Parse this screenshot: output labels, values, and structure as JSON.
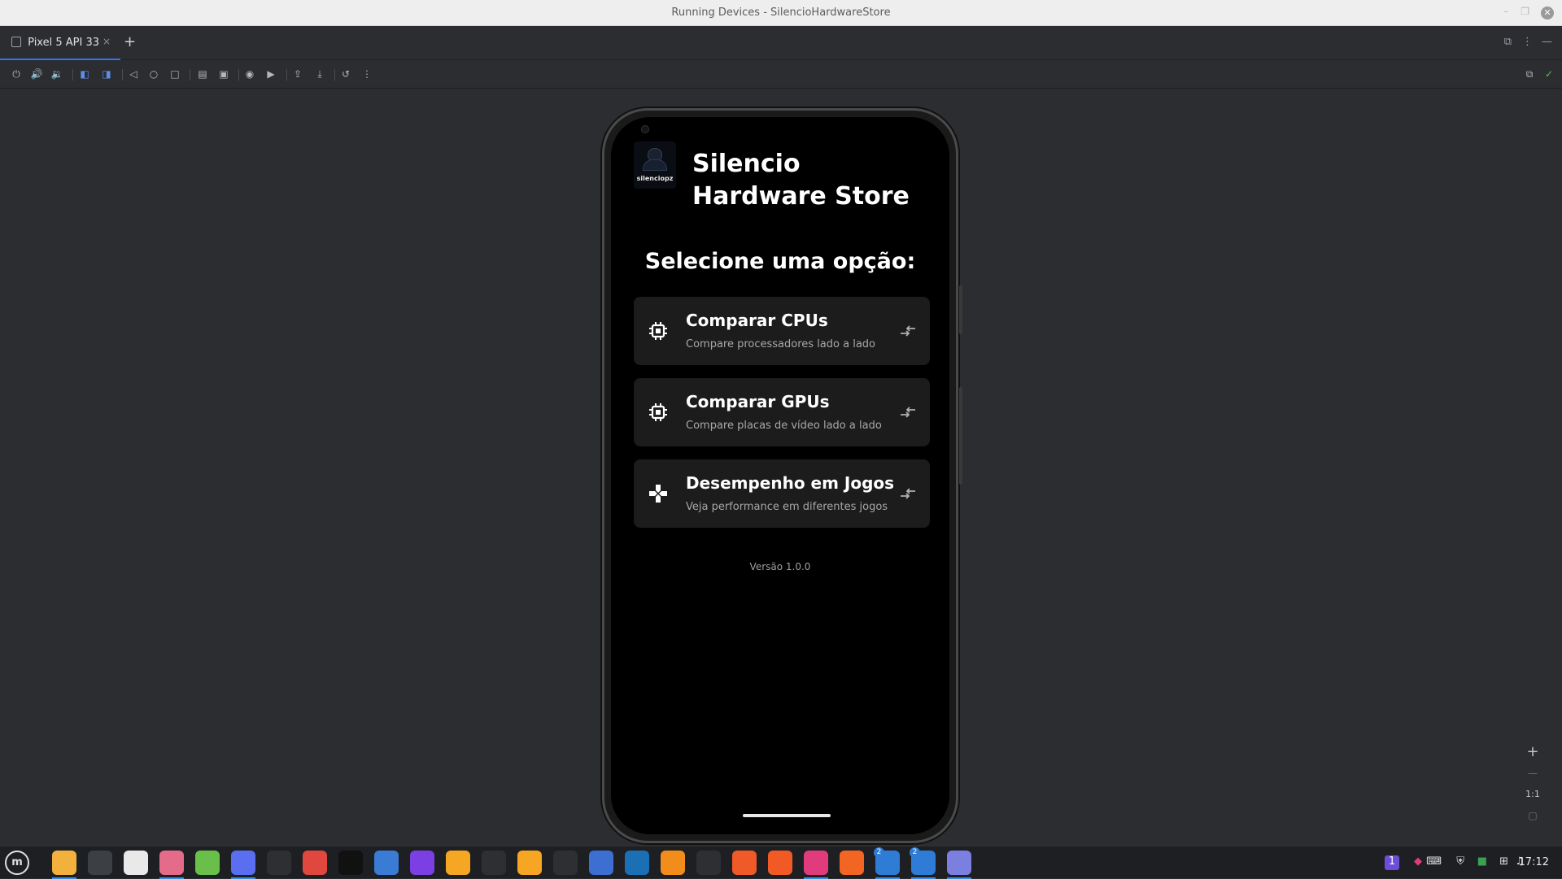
{
  "window": {
    "title": "Running Devices - SilencioHardwareStore",
    "controls": [
      "–",
      "❐",
      "✕"
    ]
  },
  "tabs": [
    {
      "label": "Pixel 5 API 33",
      "close": "×"
    }
  ],
  "add_tab": "+",
  "toolbar": {
    "left_icons": [
      "power-icon",
      "volume-up-icon",
      "volume-down-icon",
      "rotate-left-icon",
      "rotate-right-icon",
      "back-icon",
      "home-icon",
      "overview-icon",
      "fold-icon",
      "mirror-icon",
      "screenshot-icon",
      "record-icon",
      "export-icon",
      "import-icon",
      "reset-icon",
      "more-icon"
    ],
    "right_icons": [
      "device-mirror-icon",
      "check-icon"
    ]
  },
  "app": {
    "logo_text": "silenciopz",
    "title": "Silencio Hardware Store",
    "subtitle": "Selecione uma opção:",
    "cards": [
      {
        "title": "Comparar CPUs",
        "desc": "Compare processadores lado a lado",
        "icon": "cpu-chip-icon"
      },
      {
        "title": "Comparar GPUs",
        "desc": "Compare placas de vídeo lado a lado",
        "icon": "gpu-chip-icon"
      },
      {
        "title": "Desempenho em Jogos",
        "desc": "Veja performance em diferentes jogos",
        "icon": "gamepad-icon"
      }
    ],
    "version": "Versão 1.0.0"
  },
  "zoom": {
    "in": "+",
    "out": "—",
    "ratio": "1:1"
  },
  "taskbar": {
    "apps": [
      {
        "name": "files",
        "color": "#f2b13c"
      },
      {
        "name": "calculator",
        "color": "#3c3f44"
      },
      {
        "name": "calendar",
        "color": "#e9e9e9"
      },
      {
        "name": "thermometer",
        "color": "#e46c8a"
      },
      {
        "name": "spreadsheet",
        "color": "#6abf4b"
      },
      {
        "name": "vpn",
        "color": "#5a6ef0"
      },
      {
        "name": "video-editor",
        "color": "#2e2f33"
      },
      {
        "name": "screen-recorder",
        "color": "#e0473f"
      },
      {
        "name": "terminal",
        "color": "#111111"
      },
      {
        "name": "qbittorrent",
        "color": "#3a7bd5"
      },
      {
        "name": "podcast",
        "color": "#7b3fe4"
      },
      {
        "name": "game-launcher",
        "color": "#f5a623"
      },
      {
        "name": "controller",
        "color": "#2e2f33"
      },
      {
        "name": "gimp",
        "color": "#f6a623"
      },
      {
        "name": "color-picker",
        "color": "#2e2f33"
      },
      {
        "name": "bookmarks",
        "color": "#3c6fd1"
      },
      {
        "name": "steam",
        "color": "#1b6fb5"
      },
      {
        "name": "vlc",
        "color": "#f28c1a"
      },
      {
        "name": "clock",
        "color": "#2e2f33"
      },
      {
        "name": "update",
        "color": "#f05a28"
      },
      {
        "name": "brave",
        "color": "#f15a24"
      },
      {
        "name": "jetbrains",
        "color": "#e03c7d"
      },
      {
        "name": "draw",
        "color": "#f26522"
      },
      {
        "name": "android-studio",
        "color": "#2e7cd6"
      },
      {
        "name": "text-editor",
        "color": "#2e7cd6"
      },
      {
        "name": "notes",
        "color": "#7b7fe0"
      }
    ],
    "active_apps": [
      0,
      3,
      5,
      21,
      23,
      24,
      25
    ],
    "badges": {
      "23": "2",
      "24": "2"
    },
    "tray": [
      "1",
      "keyboard-icon",
      "shield-icon",
      "flag-icon",
      "network-icon",
      "music-icon"
    ],
    "clock": "17:12"
  }
}
